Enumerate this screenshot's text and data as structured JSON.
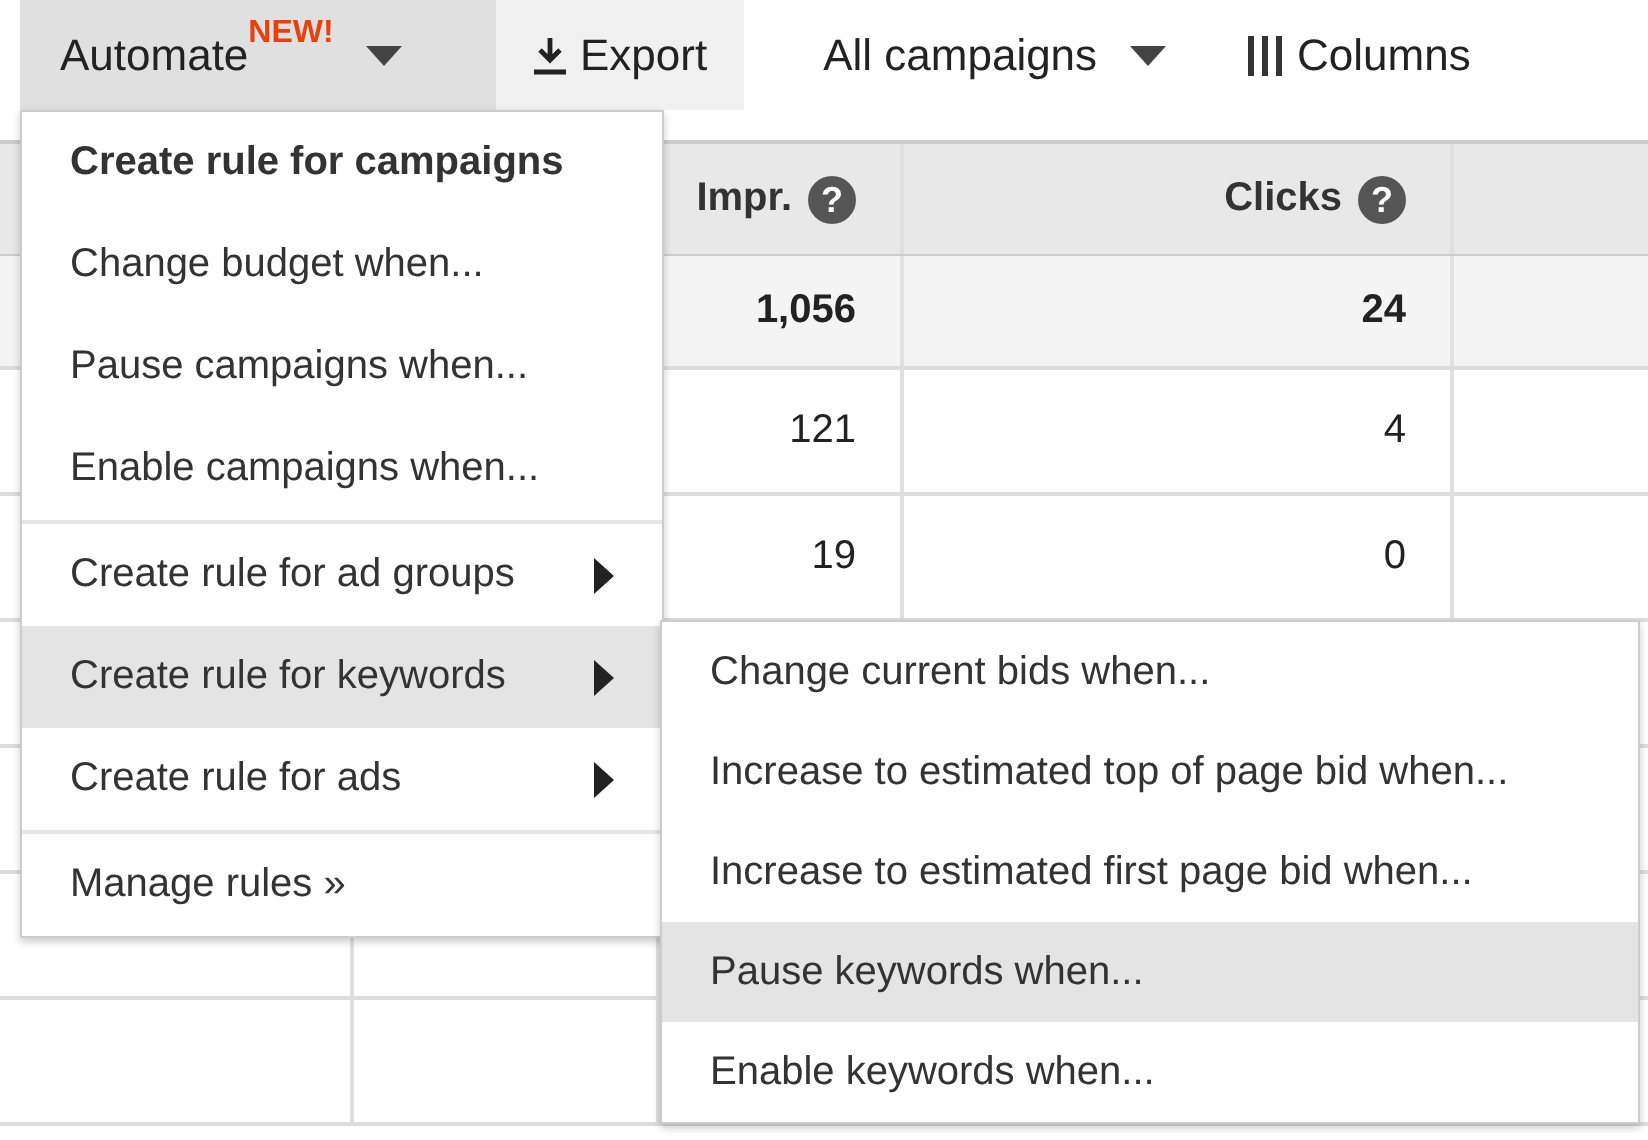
{
  "toolbar": [
    {
      "kind": "menu",
      "label": "Automate",
      "badge": "NEW!",
      "open": true
    },
    {
      "kind": "download",
      "label": "Export",
      "open": false
    },
    {
      "kind": "dropdown",
      "label": "All campaigns",
      "open": false
    },
    {
      "kind": "columns",
      "label": "Columns",
      "open": false
    }
  ],
  "table": {
    "columns": [
      {
        "label": "Impr.",
        "help": "?"
      },
      {
        "label": "Clicks",
        "help": "?"
      }
    ],
    "rows": [
      {
        "kind": "total",
        "cells": [
          "1,056",
          "24"
        ]
      },
      {
        "kind": "row",
        "cells": [
          "121",
          "4"
        ]
      },
      {
        "kind": "row",
        "cells": [
          "19",
          "0"
        ]
      }
    ]
  },
  "menu": {
    "groups": [
      [
        {
          "kind": "heading",
          "label": "Create rule for campaigns",
          "selected": false
        },
        {
          "kind": "action",
          "label": "Change budget when...",
          "selected": false
        },
        {
          "kind": "action",
          "label": "Pause campaigns when...",
          "selected": false
        },
        {
          "kind": "action",
          "label": "Enable campaigns when...",
          "selected": false
        }
      ],
      [
        {
          "kind": "submenu",
          "label": "Create rule for ad groups",
          "selected": false
        },
        {
          "kind": "submenu",
          "label": "Create rule for keywords",
          "selected": true
        },
        {
          "kind": "submenu",
          "label": "Create rule for ads",
          "selected": false
        }
      ],
      [
        {
          "kind": "link",
          "label": "Manage rules »",
          "selected": false
        }
      ]
    ]
  },
  "submenu": {
    "items": [
      {
        "label": "Change current bids when...",
        "selected": false
      },
      {
        "label": "Increase to estimated top of page bid when...",
        "selected": false
      },
      {
        "label": "Increase to estimated first page bid when...",
        "selected": false
      },
      {
        "label": "Pause keywords when...",
        "selected": true
      },
      {
        "label": "Enable keywords when...",
        "selected": false
      }
    ]
  }
}
